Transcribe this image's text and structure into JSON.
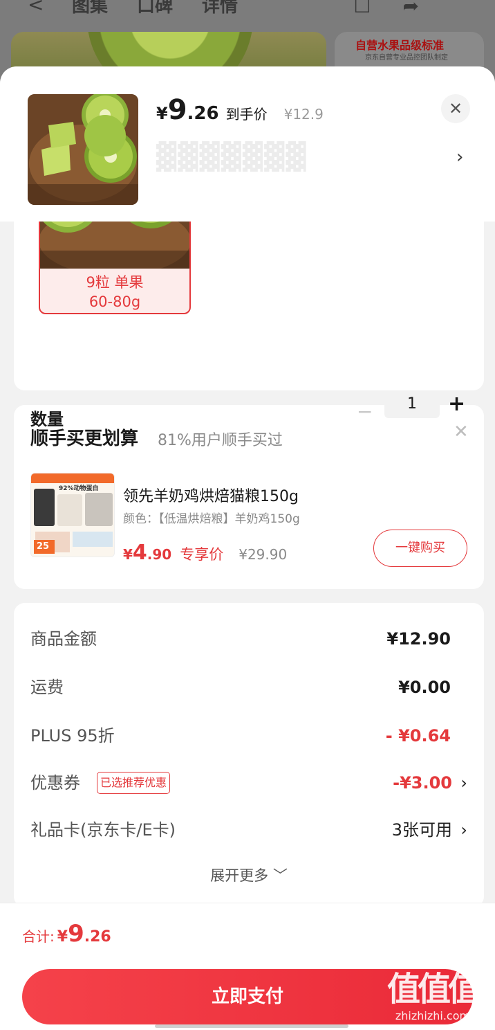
{
  "background": {
    "tabs": [
      "图集",
      "口碑",
      "详情"
    ],
    "quality_badge": "自营水果品级标准",
    "quality_sub": "京东自营专业品控团队制定"
  },
  "header": {
    "price_currency": "¥",
    "price_int": "9",
    "price_dec": ".26",
    "hand_label": "到手价",
    "original_price": "¥12.9",
    "close_icon": "close-icon",
    "chevron_icon": "chevron-right-icon"
  },
  "spec": {
    "selected_option_line1": "9粒 单果",
    "selected_option_line2": "60-80g",
    "quantity_label": "数量",
    "quantity_value": "1"
  },
  "bundle": {
    "title": "顺手买更划算",
    "subtitle": "81%用户顺手买过",
    "product_name": "领先羊奶鸡烘焙猫粮150g",
    "product_variant": "颜色：【低温烘焙粮】羊奶鸡150g",
    "img_text": "92%动物蛋白",
    "img_price_tag": "25",
    "price_currency": "¥",
    "price_int": "4",
    "price_dec": ".90",
    "price_tag": "专享价",
    "original_price": "¥29.90",
    "buy_label": "一键购买"
  },
  "summary": {
    "rows": [
      {
        "label": "商品金额",
        "value": "¥12.90"
      },
      {
        "label": "运费",
        "value": "¥0.00"
      },
      {
        "label": "PLUS 95折",
        "value": "- ¥0.64"
      },
      {
        "label": "优惠券",
        "value": "-¥3.00",
        "tag": "已选推荐优惠"
      },
      {
        "label": "礼品卡(京东卡/E卡)",
        "value": "3张可用"
      }
    ],
    "expand_label": "展开更多 ﹀"
  },
  "footer": {
    "total_label": "合计:",
    "total_currency": "¥",
    "total_int": "9",
    "total_dec": ".26",
    "pay_label": "立即支付"
  },
  "watermark": {
    "brand": "值值值",
    "site": "zhizhizhi.com"
  },
  "colors": {
    "accent": "#e4393c",
    "pay_gradient_start": "#f5424a",
    "pay_gradient_end": "#ea2a38"
  }
}
